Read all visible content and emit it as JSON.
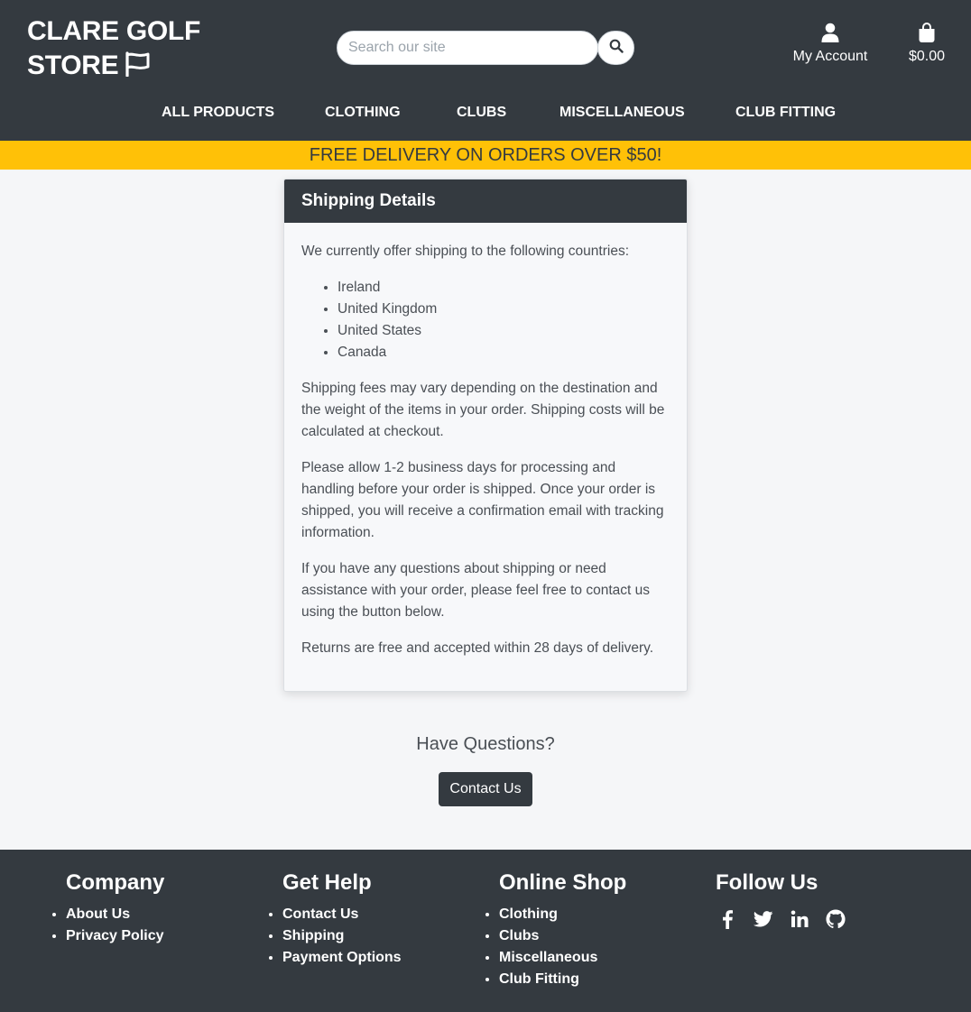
{
  "header": {
    "logo_line1": "CLARE GOLF",
    "logo_line2": "STORE",
    "search_placeholder": "Search our site",
    "account_label": "My Account",
    "cart_total": "$0.00"
  },
  "nav": [
    "ALL PRODUCTS",
    "CLOTHING",
    "CLUBS",
    "MISCELLANEOUS",
    "CLUB FITTING"
  ],
  "banner": "FREE DELIVERY ON ORDERS OVER $50!",
  "shipping": {
    "title": "Shipping Details",
    "intro": "We currently offer shipping to the following countries:",
    "countries": [
      "Ireland",
      "United Kingdom",
      "United States",
      "Canada"
    ],
    "paragraphs": [
      "Shipping fees may vary depending on the destination and the weight of the items in your order. Shipping costs will be calculated at checkout.",
      "Please allow 1-2 business days for processing and handling before your order is shipped. Once your order is shipped, you will receive a confirmation email with tracking information.",
      "If you have any questions about shipping or need assistance with your order, please feel free to contact us using the button below.",
      "Returns are free and accepted within 28 days of delivery."
    ]
  },
  "questions": {
    "heading": "Have Questions?",
    "button": "Contact Us"
  },
  "footer": {
    "company": {
      "title": "Company",
      "items": [
        "About Us",
        "Privacy Policy"
      ]
    },
    "help": {
      "title": "Get Help",
      "items": [
        "Contact Us",
        "Shipping",
        "Payment Options"
      ]
    },
    "shop": {
      "title": "Online Shop",
      "items": [
        "Clothing",
        "Clubs",
        "Miscellaneous",
        "Club Fitting"
      ]
    },
    "follow": {
      "title": "Follow Us",
      "icons": [
        "facebook-icon",
        "twitter-icon",
        "linkedin-icon",
        "github-icon"
      ]
    }
  },
  "colors": {
    "dark": "#343a40",
    "accent": "#ffc107",
    "background": "#f5f6f8"
  }
}
